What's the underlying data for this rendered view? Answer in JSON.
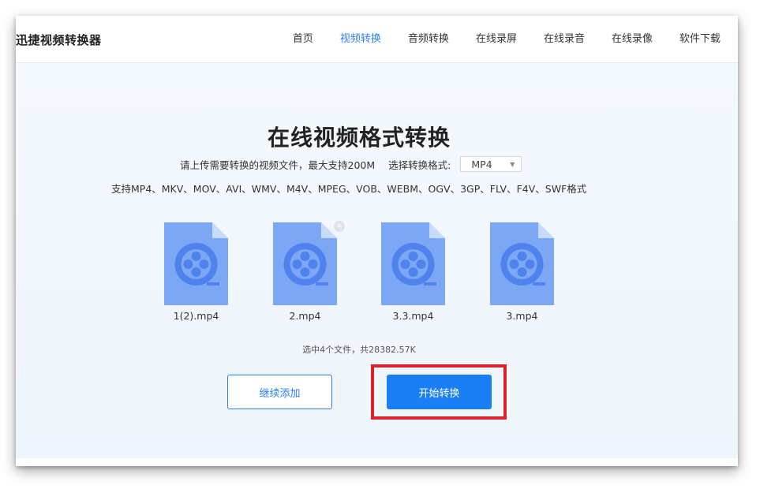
{
  "header": {
    "brand": "迅捷视频转换器",
    "nav": [
      {
        "label": "首页",
        "active": false
      },
      {
        "label": "视频转换",
        "active": true
      },
      {
        "label": "音频转换",
        "active": false
      },
      {
        "label": "在线录屏",
        "active": false
      },
      {
        "label": "在线录音",
        "active": false
      },
      {
        "label": "在线录像",
        "active": false
      },
      {
        "label": "软件下载",
        "active": false
      }
    ]
  },
  "main": {
    "title": "在线视频格式转换",
    "upload_hint": "请上传需要转换的视频文件，最大支持200M",
    "format_label": "选择转换格式:",
    "format_selected": "MP4",
    "supported_formats": "支持MP4、MKV、MOV、AVI、WMV、M4V、MPEG、VOB、WEBM、OGV、3GP、FLV、F4V、SWF格式",
    "files": [
      {
        "name": "1(2).mp4",
        "icon": "video-file-icon"
      },
      {
        "name": "2.mp4",
        "icon": "video-file-icon"
      },
      {
        "name": "3.3.mp4",
        "icon": "video-file-icon"
      },
      {
        "name": "3.mp4",
        "icon": "video-file-icon"
      }
    ],
    "remove_symbol": "×",
    "summary": "选中4个文件，共28382.57K",
    "add_button": "继续添加",
    "start_button": "开始转换"
  },
  "colors": {
    "accent": "#2d7ff9",
    "primary_button": "#1a7ff5",
    "file_icon": "#7ba7f5",
    "highlight": "#d9232e"
  }
}
